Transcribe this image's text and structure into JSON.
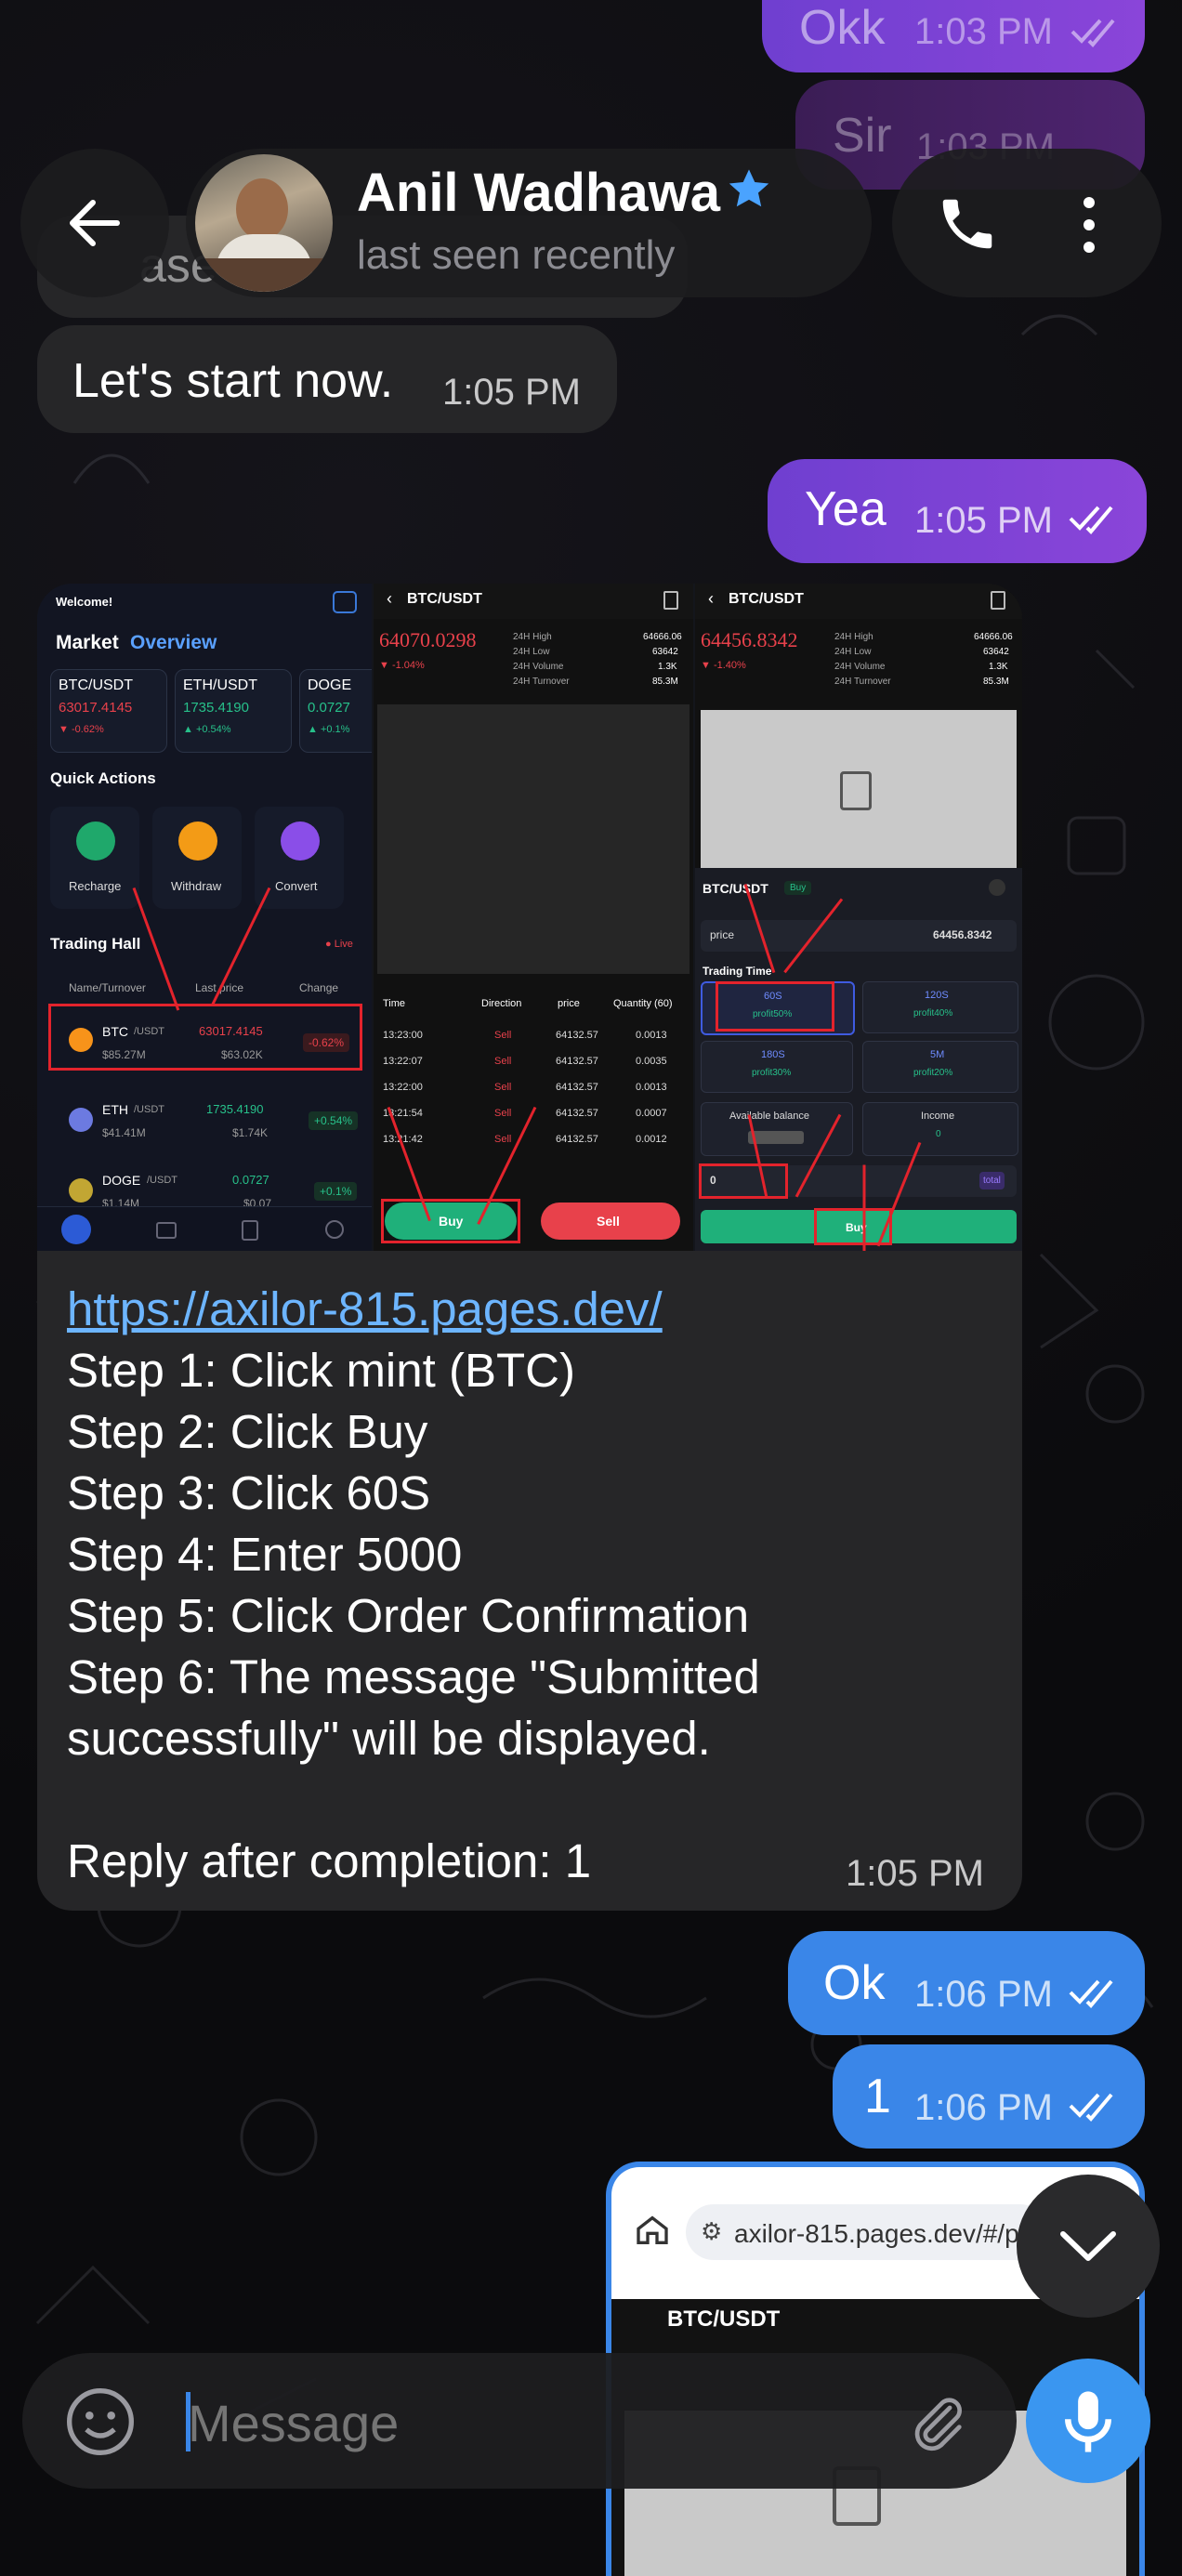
{
  "header": {
    "contact_name": "Anil Wadhawa",
    "status": "last seen recently",
    "verified": true
  },
  "top_partial": [
    {
      "text": "Okk",
      "time": "1:03 PM"
    },
    {
      "text": "Sir",
      "time": "1:03 PM"
    },
    {
      "text": "ase"
    }
  ],
  "messages": {
    "m1": {
      "text": "Let's start now.",
      "time": "1:05 PM"
    },
    "m2": {
      "text": "Yea",
      "time": "1:05 PM"
    },
    "m3": {
      "link": "https://axilor-815.pages.dev/",
      "steps": [
        "Step 1: Click mint (BTC)",
        "Step 2: Click Buy",
        "Step 3: Click 60S",
        "Step 4: Enter 5000",
        "Step 5: Click Order Confirmation",
        "Step 6: The message \"Submitted",
        "successfully\" will be displayed."
      ],
      "reply_line": "Reply after completion: 1",
      "time": "1:05 PM"
    },
    "m4": {
      "text": "Ok",
      "time": "1:06 PM"
    },
    "m5": {
      "text": "1",
      "time": "1:06 PM"
    }
  },
  "embedded_screenshot": {
    "panel1": {
      "welcome": "Welcome!",
      "title_a": "Market",
      "title_b": "Overview",
      "tickers": [
        {
          "pair": "BTC/USDT",
          "price": "63017.4145",
          "chg": "▼ -0.62%"
        },
        {
          "pair": "ETH/USDT",
          "price": "1735.4190",
          "chg": "▲ +0.54%"
        },
        {
          "pair": "DOGE",
          "price": "0.0727",
          "chg": "▲ +0.1%"
        }
      ],
      "quick_actions": "Quick Actions",
      "actions": [
        "Recharge",
        "Withdraw",
        "Convert"
      ],
      "trading_hall": "Trading Hall",
      "live": "● Live",
      "cols": [
        "Name/Turnover",
        "Last price",
        "Change"
      ],
      "rows": [
        {
          "coin": "BTC",
          "quote": "/USDT",
          "vol": "$85.27M",
          "price": "63017.4145",
          "usd": "$63.02K",
          "chg": "-0.62%"
        },
        {
          "coin": "ETH",
          "quote": "/USDT",
          "vol": "$41.41M",
          "price": "1735.4190",
          "usd": "$1.74K",
          "chg": "+0.54%"
        },
        {
          "coin": "DOGE",
          "quote": "/USDT",
          "vol": "$1.14M",
          "price": "0.0727",
          "usd": "$0.07",
          "chg": "+0.1%"
        }
      ]
    },
    "panel2": {
      "pair": "BTC/USDT",
      "price": "64070.0298",
      "chg": "▼ -1.04%",
      "stats_labels": [
        "24H High",
        "24H Low",
        "24H Volume",
        "24H Turnover"
      ],
      "stats_values": [
        "64666.06",
        "63642",
        "1.3K",
        "85.3M"
      ],
      "cols": [
        "Time",
        "Direction",
        "price",
        "Quantity (60)"
      ],
      "trades": [
        {
          "time": "13:23:00",
          "dir": "Sell",
          "price": "64132.57",
          "qty": "0.0013"
        },
        {
          "time": "13:22:07",
          "dir": "Sell",
          "price": "64132.57",
          "qty": "0.0035"
        },
        {
          "time": "13:22:00",
          "dir": "Sell",
          "price": "64132.57",
          "qty": "0.0013"
        },
        {
          "time": "13:21:54",
          "dir": "Sell",
          "price": "64132.57",
          "qty": "0.0007"
        },
        {
          "time": "13:21:42",
          "dir": "Sell",
          "price": "64132.57",
          "qty": "0.0012"
        }
      ],
      "buy": "Buy",
      "sell": "Sell"
    },
    "panel3": {
      "pair": "BTC/USDT",
      "price": "64456.8342",
      "chg": "▼ -1.40%",
      "stats_values": [
        "64666.06",
        "63642",
        "1.3K",
        "85.3M"
      ],
      "order_pair": "BTC/USDT",
      "order_tag": "Buy",
      "price_label": "price",
      "price_value": "64456.8342",
      "trading_time": "Trading Time",
      "options": [
        {
          "t": "60S",
          "p": "profit50%"
        },
        {
          "t": "120S",
          "p": "profit40%"
        },
        {
          "t": "180S",
          "p": "profit30%"
        },
        {
          "t": "5M",
          "p": "profit20%"
        }
      ],
      "available": "Available balance",
      "income": "Income",
      "income_val": "0",
      "amount": "0",
      "total": "total",
      "buy": "Buy"
    }
  },
  "browser_preview": {
    "url": "axilor-815.pages.dev/#/pa",
    "pair": "BTC/USDT"
  },
  "composer": {
    "placeholder": "Message"
  },
  "colors": {
    "outgoing_purple": "#7a42d6",
    "outgoing_blue": "#3a86e8",
    "incoming": "#262628",
    "link": "#6db5ff",
    "mic_button": "#3a96f0"
  }
}
